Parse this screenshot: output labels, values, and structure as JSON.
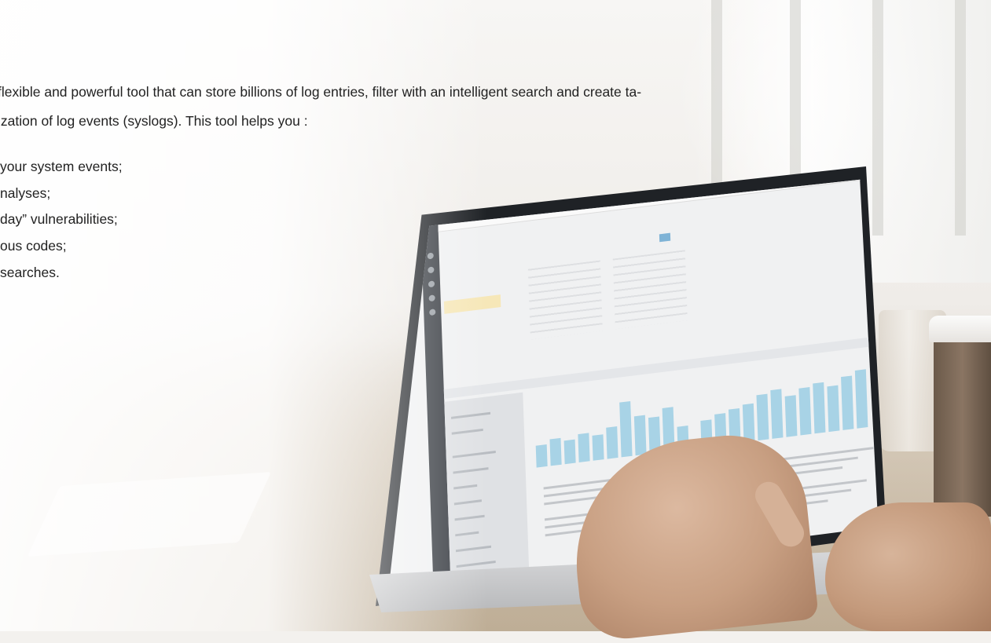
{
  "intro": {
    "line1": " flexible and powerful tool that can store billions of log entries, filter with an intelligent search and create ta-",
    "line2": "ization of log events (syslogs). This tool helps you :"
  },
  "bullets": [
    "your system events;",
    "nalyses;",
    "day” vulnerabilities;",
    "ous codes;",
    " searches."
  ],
  "colors": {
    "text": "#222222",
    "histogram": "#a8d3e6",
    "highlight": "#f6e7b8"
  },
  "photo": {
    "description_icon": "laptop-icon"
  }
}
